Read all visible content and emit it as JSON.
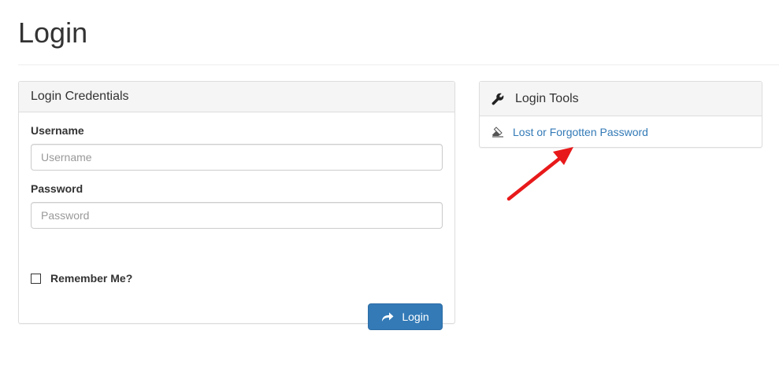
{
  "page": {
    "title": "Login"
  },
  "credentials": {
    "heading": "Login Credentials",
    "username_label": "Username",
    "username_placeholder": "Username",
    "username_value": "",
    "password_label": "Password",
    "password_placeholder": "Password",
    "password_value": "",
    "remember_label": "Remember Me?",
    "remember_checked": false,
    "login_button_label": "Login"
  },
  "tools": {
    "heading": "Login Tools",
    "links": [
      {
        "label": "Lost or Forgotten Password",
        "icon": "eraser-icon"
      }
    ]
  },
  "icons": {
    "tools_heading": "wrench-icon",
    "login_button": "share-arrow-icon"
  },
  "colors": {
    "primary": "#337ab7",
    "annotation_arrow": "#e8191a",
    "panel_heading_bg": "#f5f5f5"
  }
}
